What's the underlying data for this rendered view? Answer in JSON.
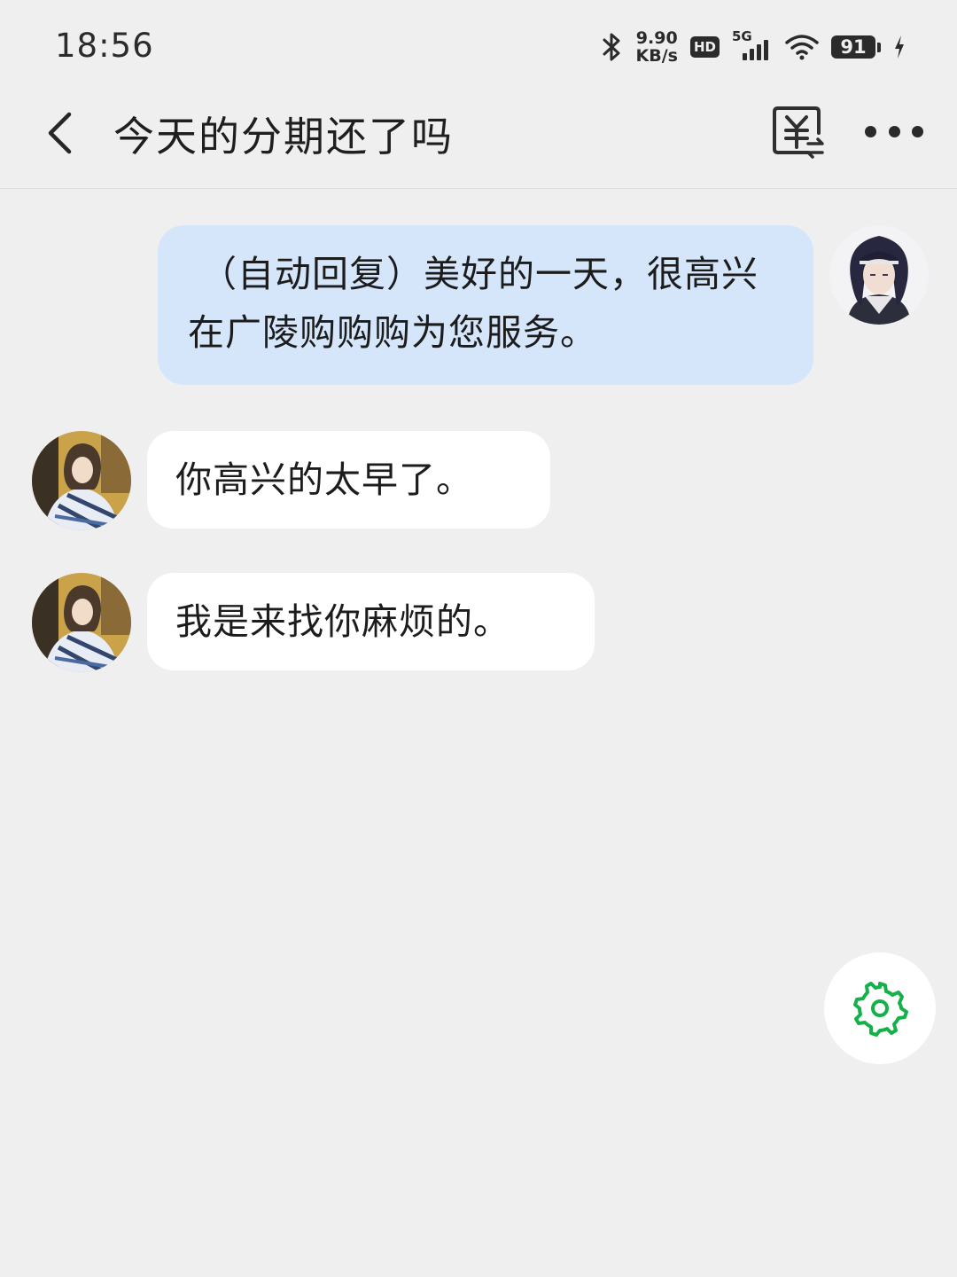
{
  "status_bar": {
    "time": "18:56",
    "net_speed_value": "9.90",
    "net_speed_unit": "KB/s",
    "hd_label": "HD",
    "network_type": "5G",
    "battery_level": "91",
    "icons": [
      "bluetooth-icon",
      "hd-icon",
      "signal-icon",
      "wifi-icon",
      "battery-icon",
      "charging-icon"
    ]
  },
  "header": {
    "title": "今天的分期还了吗",
    "back_icon": "chevron-left-icon",
    "payment_icon": "yuan-transfer-icon",
    "more_icon": "more-dots-icon"
  },
  "messages": [
    {
      "side": "right",
      "sender": "self",
      "text": "（自动回复）美好的一天，很高兴在广陵购购购为您服务。"
    },
    {
      "side": "left",
      "sender": "other",
      "text": "你高兴的太早了。"
    },
    {
      "side": "left",
      "sender": "other",
      "text": "我是来找你麻烦的。"
    }
  ],
  "fab": {
    "icon": "gear-icon",
    "color": "#14b14a"
  },
  "colors": {
    "background": "#efefef",
    "sent_bubble": "#d5e6fa",
    "received_bubble": "#ffffff"
  }
}
